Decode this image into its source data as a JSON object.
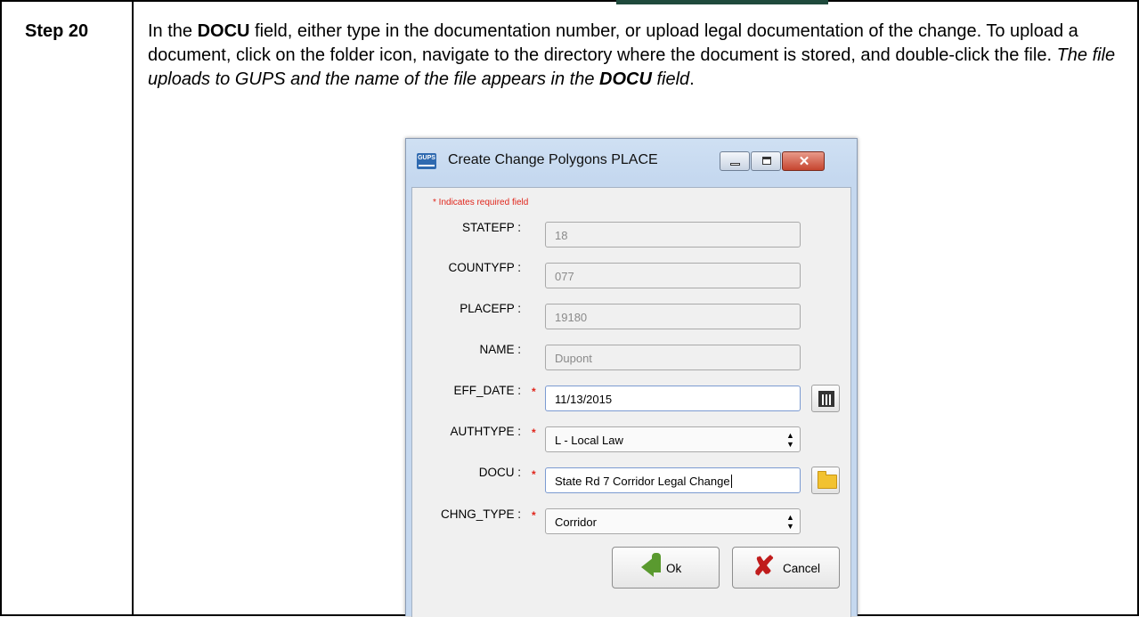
{
  "doc": {
    "step_label": "Step 20",
    "instruction": {
      "t1": "In the ",
      "b1": "DOCU",
      "t2": " field, either type in the documentation number, or upload legal documentation of the change. To upload a document, click on the folder icon, navigate to the directory where the document is stored, and double-click the file. ",
      "i1": "The file uploads to GUPS and the name of the file appears in the ",
      "bi1": "DOCU",
      "i2": " field",
      "t3": "."
    }
  },
  "dialog": {
    "app_icon_text": "GUPS",
    "title": "Create Change Polygons PLACE",
    "close_symbol": "✕",
    "required_note": "* Indicates required field",
    "required_marker": "*",
    "fields": {
      "statefp": {
        "label": "STATEFP :",
        "value": "18"
      },
      "countyfp": {
        "label": "COUNTYFP :",
        "value": "077"
      },
      "placefp": {
        "label": "PLACEFP :",
        "value": "19180"
      },
      "name": {
        "label": "NAME :",
        "value": "Dupont"
      },
      "eff_date": {
        "label": "EFF_DATE :",
        "value": "11/13/2015"
      },
      "authtype": {
        "label": "AUTHTYPE :",
        "value": "L - Local Law"
      },
      "docu": {
        "label": "DOCU :",
        "value": "State Rd 7 Corridor Legal Change"
      },
      "chng_type": {
        "label": "CHNG_TYPE :",
        "value": "Corridor"
      }
    },
    "select_arrow": "▲▼",
    "ok_label": "Ok",
    "cancel_label": "Cancel",
    "cancel_symbol": "✘",
    "colors": {
      "required": "#e0251b",
      "title_bg": "#c5d8ef",
      "close_btn": "#c6452f",
      "ok_arrow": "#5a9a2f",
      "cancel_x": "#c01c1c"
    }
  }
}
